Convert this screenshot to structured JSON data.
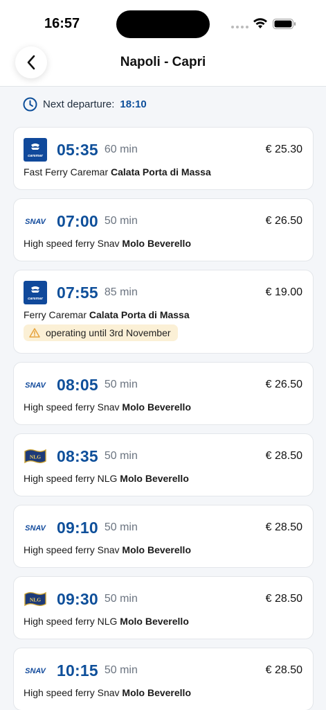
{
  "status_bar": {
    "time": "16:57"
  },
  "header": {
    "title": "Napoli - Capri"
  },
  "next_departure": {
    "label": "Next departure:",
    "time": "18:10"
  },
  "colors": {
    "accent": "#0e4f9a",
    "warning_bg": "#fbf0d6",
    "warning_icon": "#e6a23c"
  },
  "departures": [
    {
      "operator_logo": "caremar-logo-icon",
      "time": "05:35",
      "duration": "60 min",
      "price": "€ 25.30",
      "service": "Fast Ferry Caremar",
      "port": "Calata Porta di Massa"
    },
    {
      "operator_logo": "snav-logo-icon",
      "time": "07:00",
      "duration": "50 min",
      "price": "€ 26.50",
      "service": "High speed ferry Snav",
      "port": "Molo Beverello"
    },
    {
      "operator_logo": "caremar-logo-icon",
      "time": "07:55",
      "duration": "85 min",
      "price": "€ 19.00",
      "service": "Ferry Caremar",
      "port": "Calata Porta di Massa",
      "warning": "operating until 3rd November"
    },
    {
      "operator_logo": "snav-logo-icon",
      "time": "08:05",
      "duration": "50 min",
      "price": "€ 26.50",
      "service": "High speed ferry Snav",
      "port": "Molo Beverello"
    },
    {
      "operator_logo": "nlg-logo-icon",
      "time": "08:35",
      "duration": "50 min",
      "price": "€ 28.50",
      "service": "High speed ferry NLG",
      "port": "Molo Beverello"
    },
    {
      "operator_logo": "snav-logo-icon",
      "time": "09:10",
      "duration": "50 min",
      "price": "€ 28.50",
      "service": "High speed ferry Snav",
      "port": "Molo Beverello"
    },
    {
      "operator_logo": "nlg-logo-icon",
      "time": "09:30",
      "duration": "50 min",
      "price": "€ 28.50",
      "service": "High speed ferry NLG",
      "port": "Molo Beverello"
    },
    {
      "operator_logo": "snav-logo-icon",
      "time": "10:15",
      "duration": "50 min",
      "price": "€ 28.50",
      "service": "High speed ferry Snav",
      "port": "Molo Beverello"
    }
  ]
}
